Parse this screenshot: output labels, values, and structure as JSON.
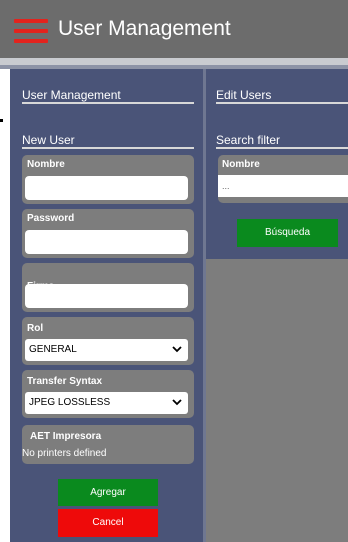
{
  "header": {
    "title": "User Management",
    "menu_icon": "hamburger-icon",
    "menu_color": "#e3231d"
  },
  "left_tab": {
    "title": "User Management"
  },
  "right_tab": {
    "title": "Edit Users"
  },
  "new_user": {
    "title": "New User",
    "nombre_label": "Nombre",
    "nombre_value": "",
    "password_label": "Password",
    "password_value": "",
    "firma_label": "Firma",
    "firma_value": "",
    "rol_label": "Rol",
    "rol_value": "GENERAL",
    "transfer_label": "Transfer Syntax",
    "transfer_value": "JPEG LOSSLESS",
    "aet_label": "AET Impresora",
    "aet_value": "No printers defined",
    "add_button": "Agregar",
    "cancel_button": "Cancel"
  },
  "search_filter": {
    "title": "Search filter",
    "nombre_label": "Nombre",
    "nombre_placeholder": "...",
    "search_button": "Búsqueda"
  },
  "colors": {
    "header_bg": "#6c6c6c",
    "panel_bg": "#4a5478",
    "card_bg": "#7d7d7d",
    "add_button": "#0a8a1e",
    "cancel_button": "#ee0a0a"
  }
}
